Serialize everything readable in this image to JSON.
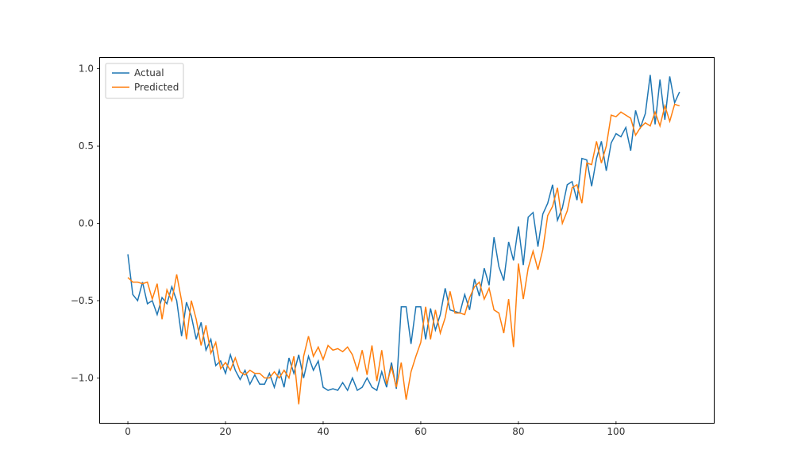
{
  "chart_data": {
    "type": "line",
    "xlabel": "",
    "ylabel": "",
    "title": "",
    "xlim": [
      -5.7,
      119.7
    ],
    "ylim": [
      -1.28,
      1.07
    ],
    "xticks": [
      0,
      20,
      40,
      60,
      80,
      100
    ],
    "yticks": [
      -1.0,
      -0.5,
      0.0,
      0.5,
      1.0
    ],
    "xtick_labels": [
      "0",
      "20",
      "40",
      "60",
      "80",
      "100"
    ],
    "ytick_labels": [
      "−1.0",
      "−0.5",
      "0.0",
      "0.5",
      "1.0"
    ],
    "legend": {
      "entries": [
        "Actual",
        "Predicted"
      ],
      "loc": "upper left"
    },
    "colors": {
      "Actual": "#1f77b4",
      "Predicted": "#ff7f0e"
    },
    "x": [
      0,
      1,
      2,
      3,
      4,
      5,
      6,
      7,
      8,
      9,
      10,
      11,
      12,
      13,
      14,
      15,
      16,
      17,
      18,
      19,
      20,
      21,
      22,
      23,
      24,
      25,
      26,
      27,
      28,
      29,
      30,
      31,
      32,
      33,
      34,
      35,
      36,
      37,
      38,
      39,
      40,
      41,
      42,
      43,
      44,
      45,
      46,
      47,
      48,
      49,
      50,
      51,
      52,
      53,
      54,
      55,
      56,
      57,
      58,
      59,
      60,
      61,
      62,
      63,
      64,
      65,
      66,
      67,
      68,
      69,
      70,
      71,
      72,
      73,
      74,
      75,
      76,
      77,
      78,
      79,
      80,
      81,
      82,
      83,
      84,
      85,
      86,
      87,
      88,
      89,
      90,
      91,
      92,
      93,
      94,
      95,
      96,
      97,
      98,
      99,
      100,
      101,
      102,
      103,
      104,
      105,
      106,
      107,
      108,
      109,
      110,
      111,
      112,
      113
    ],
    "series": [
      {
        "name": "Actual",
        "values": [
          -0.2,
          -0.46,
          -0.5,
          -0.38,
          -0.52,
          -0.5,
          -0.59,
          -0.48,
          -0.52,
          -0.41,
          -0.5,
          -0.73,
          -0.51,
          -0.6,
          -0.75,
          -0.64,
          -0.82,
          -0.75,
          -0.92,
          -0.89,
          -0.97,
          -0.85,
          -0.95,
          -1.01,
          -0.95,
          -1.04,
          -0.98,
          -1.04,
          -1.04,
          -0.97,
          -1.06,
          -0.95,
          -1.06,
          -0.87,
          -0.97,
          -0.85,
          -1.0,
          -0.86,
          -0.95,
          -0.89,
          -1.06,
          -1.08,
          -1.07,
          -1.08,
          -1.03,
          -1.08,
          -1.0,
          -1.08,
          -1.06,
          -1.0,
          -1.06,
          -1.08,
          -0.96,
          -1.06,
          -0.9,
          -1.07,
          -0.54,
          -0.54,
          -0.78,
          -0.54,
          -0.54,
          -0.75,
          -0.55,
          -0.69,
          -0.59,
          -0.42,
          -0.56,
          -0.57,
          -0.58,
          -0.46,
          -0.56,
          -0.36,
          -0.47,
          -0.29,
          -0.4,
          -0.09,
          -0.28,
          -0.37,
          -0.12,
          -0.24,
          -0.02,
          -0.27,
          0.04,
          0.07,
          -0.15,
          0.06,
          0.13,
          0.25,
          0.02,
          0.1,
          0.25,
          0.27,
          0.15,
          0.42,
          0.41,
          0.24,
          0.42,
          0.53,
          0.34,
          0.52,
          0.58,
          0.56,
          0.62,
          0.47,
          0.73,
          0.62,
          0.71,
          0.96,
          0.64,
          0.93,
          0.67,
          0.95,
          0.78,
          0.85
        ]
      },
      {
        "name": "Predicted",
        "values": [
          -0.35,
          -0.38,
          -0.38,
          -0.39,
          -0.38,
          -0.49,
          -0.39,
          -0.62,
          -0.43,
          -0.5,
          -0.33,
          -0.5,
          -0.75,
          -0.5,
          -0.62,
          -0.79,
          -0.66,
          -0.84,
          -0.77,
          -0.94,
          -0.9,
          -0.95,
          -0.87,
          -0.96,
          -0.98,
          -0.95,
          -0.97,
          -0.97,
          -1.0,
          -1.0,
          -0.96,
          -1.0,
          -0.95,
          -1.0,
          -0.86,
          -1.17,
          -0.86,
          -0.73,
          -0.86,
          -0.8,
          -0.88,
          -0.79,
          -0.82,
          -0.81,
          -0.83,
          -0.8,
          -0.85,
          -0.95,
          -0.82,
          -0.98,
          -0.79,
          -1.02,
          -0.82,
          -1.04,
          -0.93,
          -1.06,
          -0.9,
          -1.14,
          -0.96,
          -0.86,
          -0.77,
          -0.54,
          -0.75,
          -0.56,
          -0.71,
          -0.61,
          -0.44,
          -0.58,
          -0.58,
          -0.59,
          -0.48,
          -0.41,
          -0.38,
          -0.49,
          -0.42,
          -0.56,
          -0.58,
          -0.71,
          -0.49,
          -0.8,
          -0.26,
          -0.49,
          -0.29,
          -0.18,
          -0.3,
          -0.17,
          0.05,
          0.11,
          0.23,
          0.0,
          0.08,
          0.23,
          0.25,
          0.13,
          0.39,
          0.38,
          0.53,
          0.39,
          0.5,
          0.7,
          0.69,
          0.72,
          0.7,
          0.68,
          0.57,
          0.62,
          0.65,
          0.63,
          0.72,
          0.63,
          0.76,
          0.66,
          0.77,
          0.76
        ]
      }
    ]
  }
}
